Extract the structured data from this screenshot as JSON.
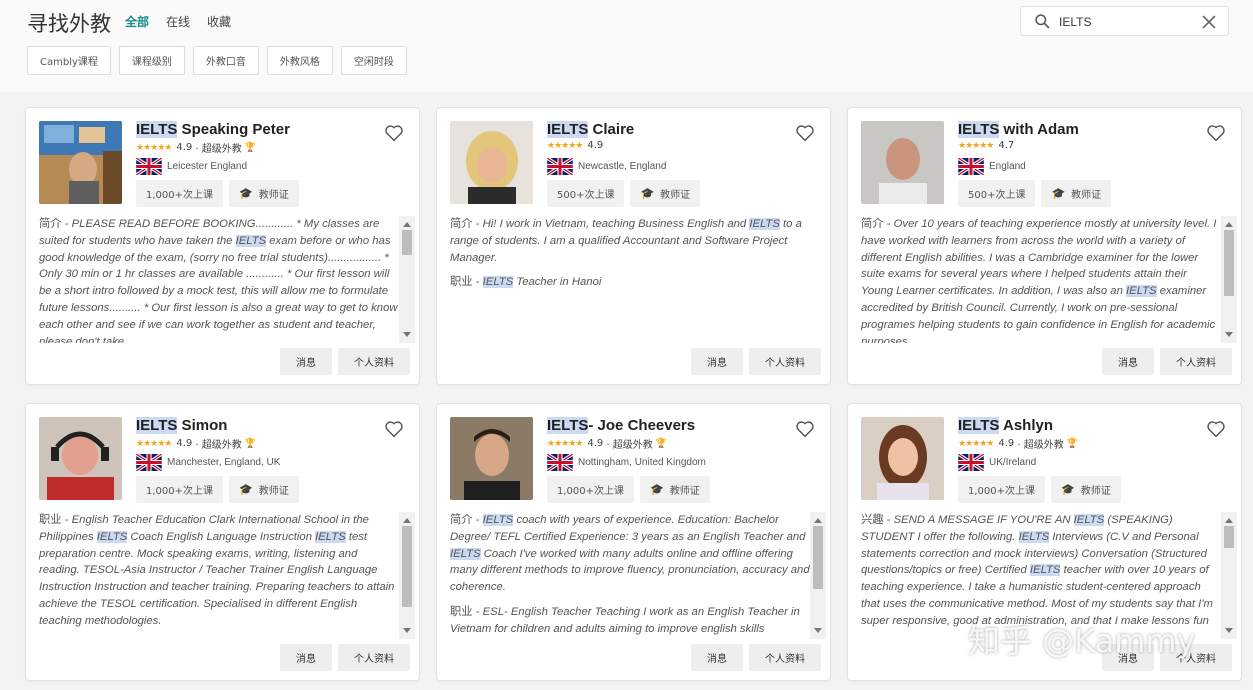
{
  "header": {
    "title": "寻找外教",
    "tabs": [
      "全部",
      "在线",
      "收藏"
    ]
  },
  "search": {
    "value": "IELTS",
    "placeholder": ""
  },
  "filters": [
    "Cambly课程",
    "课程级别",
    "外教口音",
    "外教风格",
    "空闲时段"
  ],
  "buttons": {
    "message": "消息",
    "profile": "个人资料"
  },
  "colors": {
    "accent": "#1a8a8a",
    "highlight": "#cbd9f3",
    "star": "#f2a51c"
  },
  "tutors": [
    {
      "name": "IELTS Speaking Peter",
      "rating": "4.9",
      "super_label": "· 超级外教",
      "location": "Leicester England",
      "flag": "uk",
      "lessons": "1,000+次上课",
      "cert": "教师证",
      "desc_label": "简介 - ",
      "desc": "PLEASE READ BEFORE BOOKING............ * My classes are suited for students who have taken the IELTS exam before or who has good knowledge of the exam, (sorry no free trial students)................. * Only 30 min or 1 hr classes are available ............ * Our first lesson will be a short intro followed by a mock test, this will allow me to formulate future lessons.......... * Our first lesson is also a great way to get to know each other and see if we can work together as student and teacher, please don't take",
      "job_label": "",
      "job": "",
      "scroll_thumb": [
        0.11,
        0.36
      ]
    },
    {
      "name": "IELTS Claire",
      "rating": "4.9",
      "super_label": "",
      "location": "Newcastle, England",
      "flag": "uk",
      "lessons": "500+次上课",
      "cert": "教师证",
      "desc_label": "简介 - ",
      "desc": "Hi! I work in Vietnam, teaching Business English and IELTS to a range of students. I am a qualified Accountant and Software Project Manager.",
      "job_label": "职业 - ",
      "job": "IELTS Teacher in Hanoi",
      "scroll_thumb": null
    },
    {
      "name": "IELTS with Adam",
      "rating": "4.7",
      "super_label": "",
      "location": "England",
      "flag": "uk",
      "lessons": "500+次上课",
      "cert": "教师证",
      "desc_label": "简介 - ",
      "desc": "Over 10 years of teaching experience mostly at university level. I have worked with learners from across the world with a variety of different English abilities. I was a Cambridge examiner for the lower suite exams for several years where I helped students attain their Young Learner certificates. In addition, I was also an IELTS examiner accredited by British Council. Currently, I work on pre-sessional programes helping students to gain confidence in English for academic purposes",
      "job_label": "",
      "job": "",
      "scroll_thumb": [
        0.11,
        0.78
      ]
    },
    {
      "name": "IELTS Simon",
      "rating": "4.9",
      "super_label": "· 超级外教",
      "location": "Manchester, England, UK",
      "flag": "uk",
      "lessons": "1,000+次上课",
      "cert": "教师证",
      "desc_label": "职业 - ",
      "desc": "English Teacher Education Clark International School in the Philippines IELTS Coach English Language Instruction IELTS test preparation centre. Mock speaking exams, writing, listening and reading. TESOL-Asia Instructor / Teacher Trainer English Language Instruction Instruction and teacher training. Preparing teachers to attain achieve the TESOL certification. Specialised in different English teaching methodologies.",
      "job_label": "",
      "job": "",
      "scroll_thumb": [
        0.11,
        0.93
      ]
    },
    {
      "name": "IELTS- Joe Cheevers",
      "rating": "4.9",
      "super_label": "· 超级外教",
      "location": "Nottingham, United Kingdom",
      "flag": "uk",
      "lessons": "1,000+次上课",
      "cert": "教师证",
      "desc_label": "简介 - ",
      "desc": "IELTS coach with years of experience. Education: Bachelor Degree/ TEFL Certified Experience: 3 years as an English Teacher and IELTS Coach I've worked with many adults online and offline offering many different methods to improve fluency, pronunciation, accuracy and coherence.",
      "job_label": "职业 - ",
      "job": "ESL- English Teacher Teaching I work as an English Teacher in Vietnam for children and adults aiming to improve english skills",
      "scroll_thumb": [
        0.11,
        0.75
      ]
    },
    {
      "name": "IELTS Ashlyn",
      "rating": "4.9",
      "super_label": "· 超级外教",
      "location": "UK/Ireland",
      "flag": "uk",
      "lessons": "1,000+次上课",
      "cert": "教师证",
      "desc_label": "兴趣 - ",
      "desc": "SEND A MESSAGE IF YOU'RE AN IELTS (SPEAKING) STUDENT I offer the following. IELTS Interviews (C.V and Personal statements correction and mock interviews) Conversation (Structured questions/topics or free) Certified IELTS teacher with over 10 years of teaching experience. I take a humanistic student-centered approach that uses the communicative method. Most of my students say that I'm super responsive, good at administration, and that I make lessons fun",
      "job_label": "",
      "job": "",
      "scroll_thumb": [
        0.11,
        0.33
      ]
    }
  ],
  "watermark": "知乎 @Kammy"
}
